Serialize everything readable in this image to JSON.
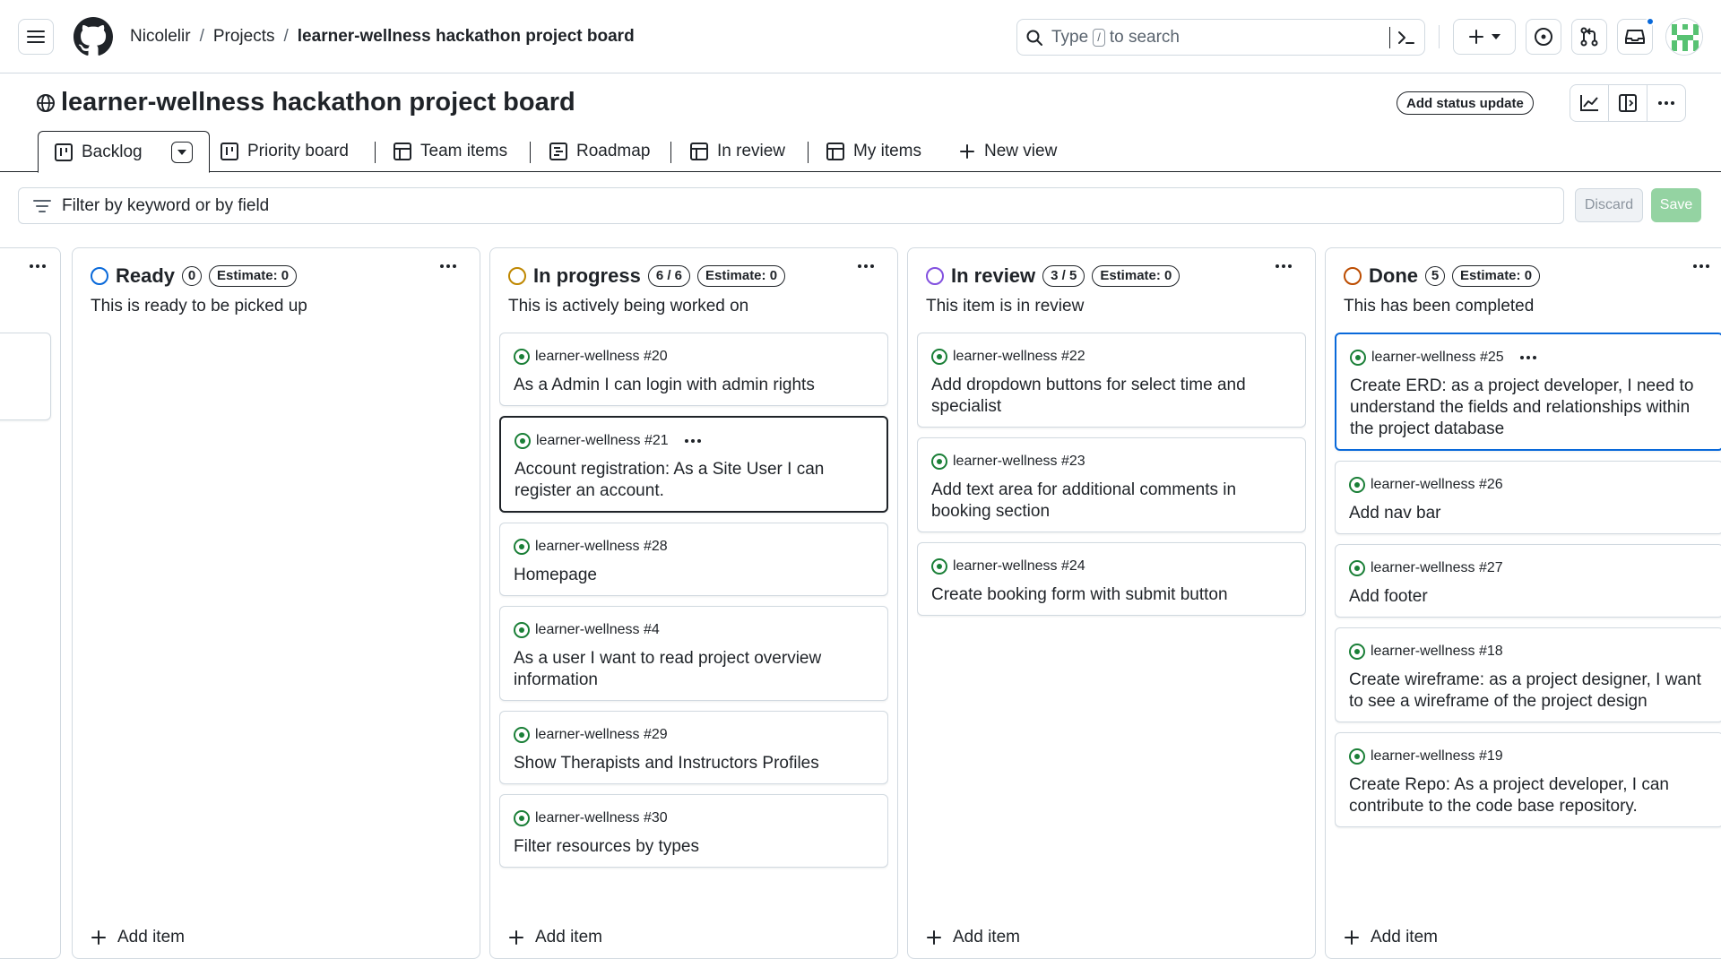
{
  "header": {
    "breadcrumbs": [
      "Nicolelir",
      "Projects",
      "learner-wellness hackathon project board"
    ],
    "search_placeholder_pre": "Type",
    "search_key": "/",
    "search_placeholder_post": "to search"
  },
  "project": {
    "title": "learner-wellness hackathon project board",
    "status_update_label": "Add status update"
  },
  "tabs": [
    {
      "label": "Backlog",
      "icon": "board-icon"
    },
    {
      "label": "Priority board",
      "icon": "board-icon"
    },
    {
      "label": "Team items",
      "icon": "table-icon"
    },
    {
      "label": "Roadmap",
      "icon": "roadmap-icon"
    },
    {
      "label": "In review",
      "icon": "table-icon"
    },
    {
      "label": "My items",
      "icon": "table-icon"
    },
    {
      "label": "New view",
      "icon": "plus-icon"
    }
  ],
  "filter": {
    "placeholder": "Filter by keyword or by field",
    "discard_label": "Discard",
    "save_label": "Save"
  },
  "columns": [
    {
      "name": "Ready",
      "count": "0",
      "estimate": "Estimate: 0",
      "description": "This is ready to be picked up",
      "color": "#0969da",
      "add_label": "Add item",
      "cards": []
    },
    {
      "name": "In progress",
      "count": "6 / 6",
      "estimate": "Estimate: 0",
      "description": "This is actively being worked on",
      "color": "#bf8700",
      "add_label": "Add item",
      "cards": [
        {
          "ref": "learner-wellness #20",
          "title": "As a Admin I can login with admin rights"
        },
        {
          "ref": "learner-wellness #21",
          "title": "Account registration: As a Site User I can register an account."
        },
        {
          "ref": "learner-wellness #28",
          "title": "Homepage"
        },
        {
          "ref": "learner-wellness #4",
          "title": "As a user I want to read project overview information"
        },
        {
          "ref": "learner-wellness #29",
          "title": "Show Therapists and Instructors Profiles"
        },
        {
          "ref": "learner-wellness #30",
          "title": "Filter resources by types"
        }
      ]
    },
    {
      "name": "In review",
      "count": "3 / 5",
      "estimate": "Estimate: 0",
      "description": "This item is in review",
      "color": "#8250df",
      "add_label": "Add item",
      "cards": [
        {
          "ref": "learner-wellness #22",
          "title": "Add dropdown buttons for select time and specialist"
        },
        {
          "ref": "learner-wellness #23",
          "title": "Add text area for additional comments in booking section"
        },
        {
          "ref": "learner-wellness #24",
          "title": "Create booking form with submit button"
        }
      ]
    },
    {
      "name": "Done",
      "count": "5",
      "estimate": "Estimate: 0",
      "description": "This has been completed",
      "color": "#bc4c00",
      "add_label": "Add item",
      "cards": [
        {
          "ref": "learner-wellness #25",
          "title": "Create ERD: as a project developer, I need to understand the fields and relationships within the project database"
        },
        {
          "ref": "learner-wellness #26",
          "title": "Add nav bar"
        },
        {
          "ref": "learner-wellness #27",
          "title": "Add footer"
        },
        {
          "ref": "learner-wellness #18",
          "title": "Create wireframe: as a project designer, I want to see a wireframe of the project design"
        },
        {
          "ref": "learner-wellness #19",
          "title": "Create Repo: As a project developer, I can contribute to the code base repository."
        }
      ]
    }
  ]
}
